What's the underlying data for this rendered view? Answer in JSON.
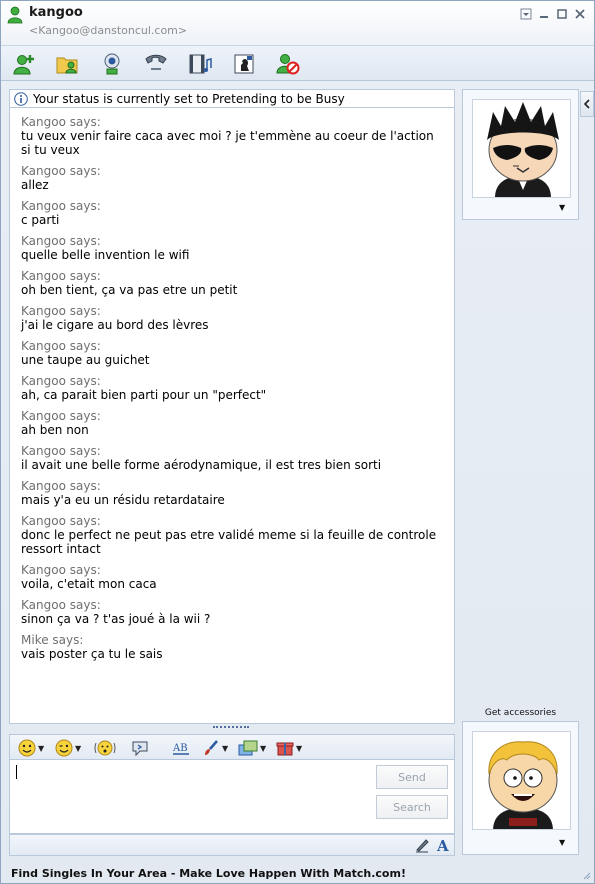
{
  "window": {
    "contact_name": "kangoo",
    "contact_email": "<Kangoo@danstoncul.com>"
  },
  "toolbar": {
    "buttons": [
      {
        "name": "invite-contact",
        "icon": "add-contact-icon"
      },
      {
        "name": "send-files",
        "icon": "folder-share-icon"
      },
      {
        "name": "video-call",
        "icon": "webcam-icon"
      },
      {
        "name": "voice-call",
        "icon": "phone-icon"
      },
      {
        "name": "activities",
        "icon": "film-music-icon"
      },
      {
        "name": "games",
        "icon": "chess-game-icon"
      },
      {
        "name": "block",
        "icon": "block-contact-icon"
      }
    ]
  },
  "status": {
    "text": "Your status is currently set to Pretending to be Busy"
  },
  "conversation": {
    "messages": [
      {
        "sender": "Kangoo says:",
        "text": "tu veux venir faire caca avec moi ? je t'emmène au coeur de l'action si tu veux"
      },
      {
        "sender": "Kangoo says:",
        "text": "allez"
      },
      {
        "sender": "Kangoo says:",
        "text": "c parti"
      },
      {
        "sender": "Kangoo says:",
        "text": "quelle belle invention le wifi"
      },
      {
        "sender": "Kangoo says:",
        "text": "oh ben tient, ça va pas etre un petit"
      },
      {
        "sender": "Kangoo says:",
        "text": "j'ai le cigare au bord des lèvres"
      },
      {
        "sender": "Kangoo says:",
        "text": "une taupe au guichet"
      },
      {
        "sender": "Kangoo says:",
        "text": "ah, ca parait bien parti pour un \"perfect\""
      },
      {
        "sender": "Kangoo says:",
        "text": "ah ben non"
      },
      {
        "sender": "Kangoo says:",
        "text": "il avait une belle forme aérodynamique, il est tres bien sorti"
      },
      {
        "sender": "Kangoo says:",
        "text": "mais y'a eu un résidu retardataire"
      },
      {
        "sender": "Kangoo says:",
        "text": "donc le perfect ne peut pas etre validé meme si la feuille de controle ressort intact"
      },
      {
        "sender": "Kangoo says:",
        "text": "voila, c'etait mon caca"
      },
      {
        "sender": "Kangoo says:",
        "text": "sinon ça va ? t'as joué à la wii ?"
      },
      {
        "sender": "Mike says:",
        "text": "vais poster ça tu le sais"
      }
    ]
  },
  "input": {
    "value": "",
    "send_label": "Send",
    "search_label": "Search"
  },
  "sidebar": {
    "accessories_label": "Get accessories"
  },
  "ad": {
    "text": "Find Singles In Your Area - Make Love Happen With Match.com!"
  },
  "colors": {
    "accent": "#3a64a8",
    "border": "#b9c9db",
    "sender_gray": "#6f6f6f"
  }
}
